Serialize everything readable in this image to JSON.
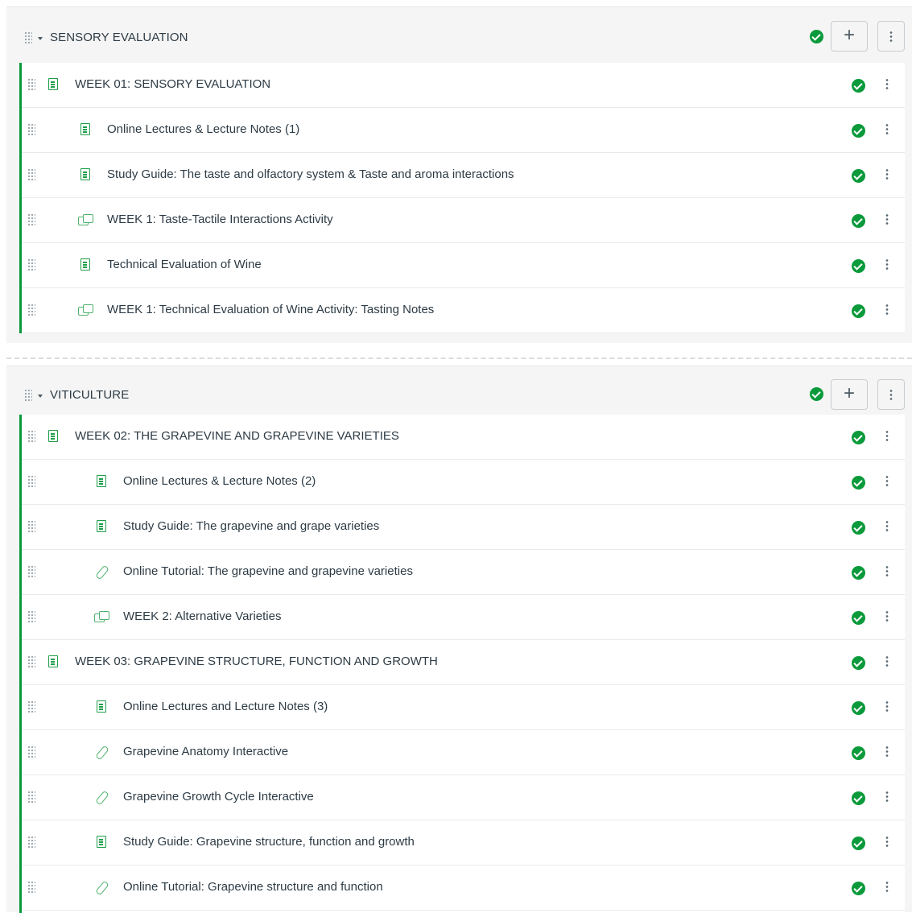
{
  "modules": [
    {
      "title": "SENSORY EVALUATION",
      "add_label": "+",
      "items": [
        {
          "title": "WEEK 01: SENSORY EVALUATION",
          "icon": "page-icon",
          "header": true
        },
        {
          "title": "Online Lectures & Lecture Notes (1)",
          "icon": "page-icon"
        },
        {
          "title": "Study Guide: The taste and olfactory system & Taste and aroma interactions",
          "icon": "page-icon"
        },
        {
          "title": "WEEK 1: Taste-Tactile Interactions Activity",
          "icon": "discussion-icon"
        },
        {
          "title": "Technical Evaluation of Wine",
          "icon": "page-icon"
        },
        {
          "title": "WEEK 1: Technical Evaluation of Wine Activity: Tasting Notes",
          "icon": "discussion-icon"
        }
      ]
    },
    {
      "title": "VITICULTURE",
      "add_label": "+",
      "items": [
        {
          "title": "WEEK 02: THE GRAPEVINE AND GRAPEVINE VARIETIES",
          "icon": "page-icon",
          "header": true
        },
        {
          "title": "Online Lectures & Lecture Notes (2)",
          "icon": "page-icon"
        },
        {
          "title": "Study Guide: The grapevine and grape varieties",
          "icon": "page-icon"
        },
        {
          "title": "Online Tutorial: The grapevine and grapevine varieties",
          "icon": "link-icon"
        },
        {
          "title": "WEEK 2: Alternative Varieties",
          "icon": "discussion-icon"
        },
        {
          "title": "WEEK 03: GRAPEVINE STRUCTURE, FUNCTION AND GROWTH",
          "icon": "page-icon",
          "header": true
        },
        {
          "title": "Online Lectures and Lecture Notes (3)",
          "icon": "page-icon"
        },
        {
          "title": "Grapevine Anatomy Interactive",
          "icon": "link-icon"
        },
        {
          "title": "Grapevine Growth Cycle Interactive",
          "icon": "link-icon"
        },
        {
          "title": "Study Guide: Grapevine structure, function and growth",
          "icon": "page-icon"
        },
        {
          "title": "Online Tutorial: Grapevine structure and function",
          "icon": "link-icon"
        }
      ]
    }
  ],
  "colors": {
    "published": "#0b9a3b",
    "accent_border": "#0b9a3b",
    "icon_green": "#1e9e4a",
    "text": "#2d3b45"
  }
}
